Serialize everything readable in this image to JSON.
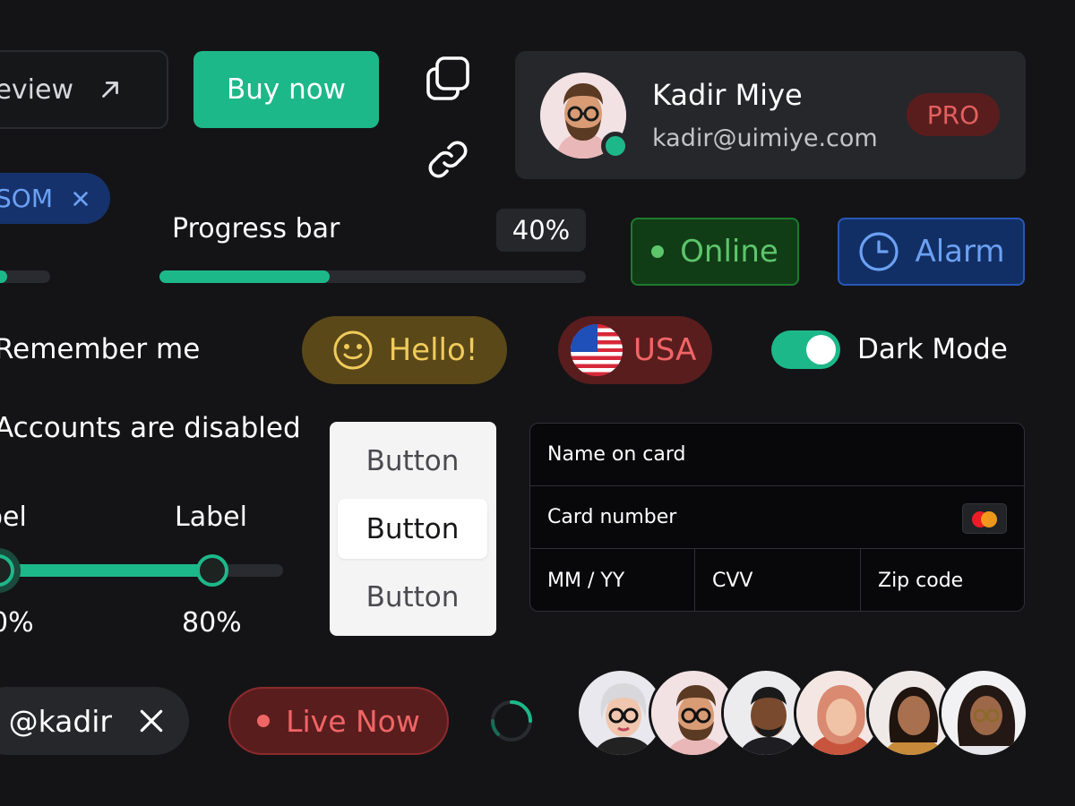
{
  "preview_button": {
    "label": "eview"
  },
  "buy_button": {
    "label": "Buy now"
  },
  "profile": {
    "name": "Kadir Miye",
    "email": "kadir@uimiye.com",
    "badge": "PRO",
    "status": "online"
  },
  "tag_som": {
    "label": "SOM"
  },
  "progress": {
    "label": "Progress bar",
    "value_text": "40%",
    "value": 0.4
  },
  "badges": {
    "online": "Online",
    "alarm": "Alarm"
  },
  "checkbox": {
    "remember": "Remember me",
    "accounts": "Accounts are disabled"
  },
  "chips": {
    "hello": "Hello!",
    "usa": "USA"
  },
  "toggle": {
    "label": "Dark Mode",
    "on": true
  },
  "range": {
    "label_left": "bel",
    "label_right": "Label",
    "value_left": "0%",
    "value_right": "80%",
    "low": 0.0,
    "high": 0.8
  },
  "segmented": {
    "items": [
      "Button",
      "Button",
      "Button"
    ],
    "active_index": 1
  },
  "card_form": {
    "name_on_card": "Name on card",
    "card_number": "Card number",
    "expiry": "MM / YY",
    "cvv": "CVV",
    "zip": "Zip code"
  },
  "user_tag": {
    "label": "@kadir"
  },
  "live": {
    "label": "Live Now"
  },
  "colors": {
    "accent_green": "#1db889",
    "background": "#141416",
    "surface": "#26272b",
    "danger": "#f06565",
    "info": "#6ba1f4",
    "warning": "#f0ca5c"
  },
  "avatars": [
    "avatar-1",
    "avatar-2",
    "avatar-3",
    "avatar-4",
    "avatar-5",
    "avatar-6"
  ]
}
